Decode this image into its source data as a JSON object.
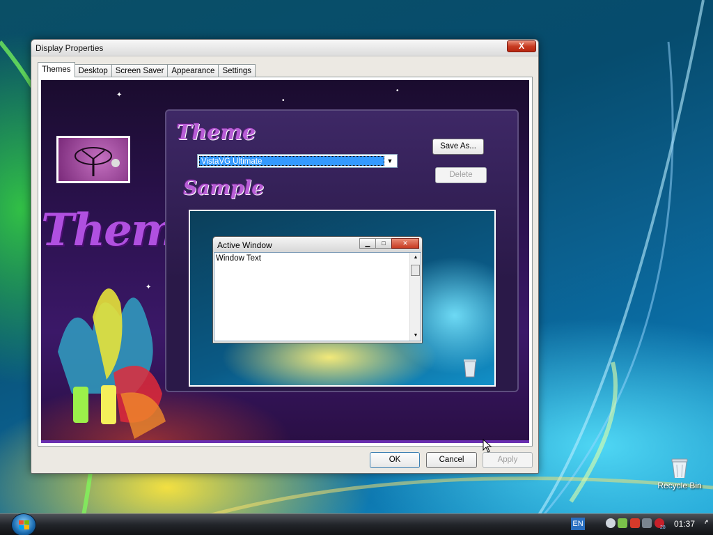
{
  "window": {
    "title": "Display Properties",
    "close_label": "X"
  },
  "tabs": [
    "Themes",
    "Desktop",
    "Screen Saver",
    "Appearance",
    "Settings"
  ],
  "themes_tab": {
    "big_heading": "Themes",
    "theme_heading": "Theme",
    "sample_heading": "Sample",
    "theme_select": {
      "value": "VistaVG Ultimate"
    },
    "save_as_label": "Save As...",
    "delete_label": "Delete",
    "sample_window": {
      "title": "Active Window",
      "body_text": "Window Text"
    }
  },
  "footer": {
    "ok_label": "OK",
    "cancel_label": "Cancel",
    "apply_label": "Apply"
  },
  "desktop": {
    "recycle_bin_label": "Recycle Bin"
  },
  "taskbar": {
    "language": "EN",
    "clock": "01:37",
    "ampm": "م",
    "tray_badge": "28"
  }
}
